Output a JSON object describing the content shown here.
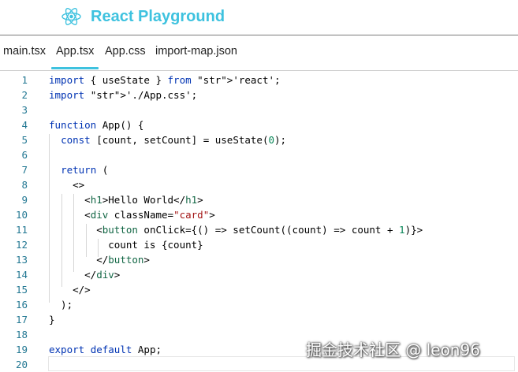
{
  "header": {
    "title": "React Playground",
    "logo_icon": "react-atom-icon",
    "accent": "#3ec2df"
  },
  "tabs": [
    {
      "label": "main.tsx",
      "active": false
    },
    {
      "label": "App.tsx",
      "active": true
    },
    {
      "label": "App.css",
      "active": false
    },
    {
      "label": "import-map.json",
      "active": false
    }
  ],
  "editor": {
    "lines": [
      "import { useState } from 'react';",
      "import './App.css';",
      "",
      "function App() {",
      "  const [count, setCount] = useState(0);",
      "",
      "  return (",
      "    <>",
      "      <h1>Hello World</h1>",
      "      <div className=\"card\">",
      "        <button onClick={() => setCount((count) => count + 1)}>",
      "          count is {count}",
      "        </button>",
      "      </div>",
      "    </>",
      "  );",
      "}",
      "",
      "export default App;",
      ""
    ]
  },
  "watermark": "掘金技术社区 @ leon96"
}
